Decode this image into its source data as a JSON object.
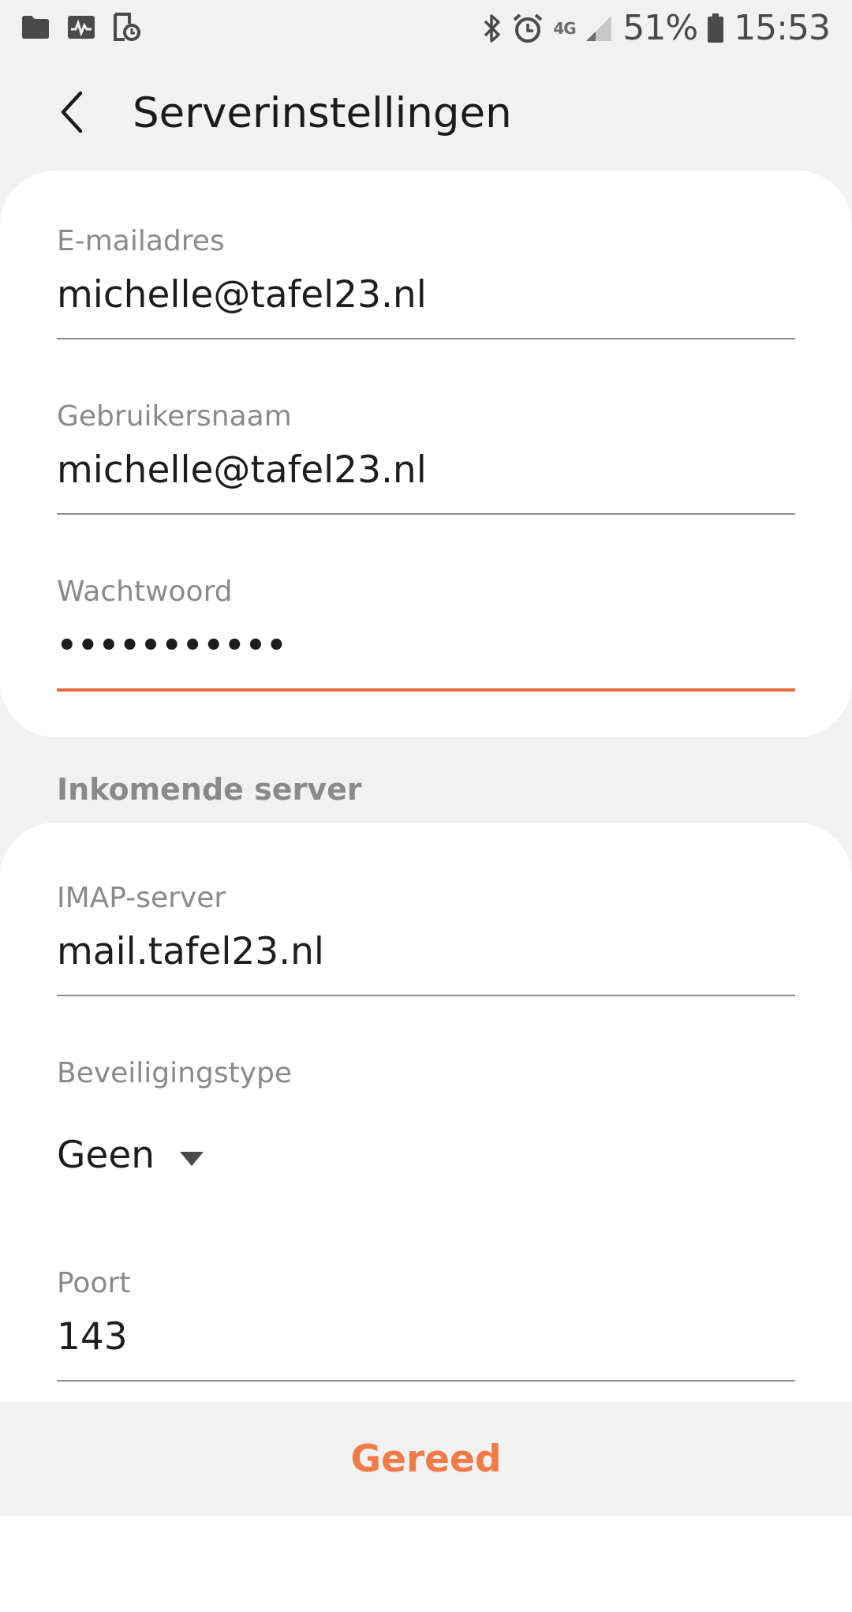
{
  "status_bar": {
    "network": "4G",
    "battery_percent": "51%",
    "time": "15:53"
  },
  "app_bar": {
    "title": "Serverinstellingen"
  },
  "account": {
    "email_label": "E-mailadres",
    "email_value": "michelle@tafel23.nl",
    "username_label": "Gebruikersnaam",
    "username_value": "michelle@tafel23.nl",
    "password_label": "Wachtwoord",
    "password_value": "•••••••••••"
  },
  "incoming": {
    "section_title": "Inkomende server",
    "imap_label": "IMAP-server",
    "imap_value": "mail.tafel23.nl",
    "security_label": "Beveiligingstype",
    "security_value": "Geen",
    "port_label": "Poort",
    "port_value": "143"
  },
  "footer": {
    "done_label": "Gereed"
  },
  "colors": {
    "accent": "#e46a3c",
    "button": "#f07a48",
    "background": "#f1f1f1",
    "card": "#ffffff"
  }
}
